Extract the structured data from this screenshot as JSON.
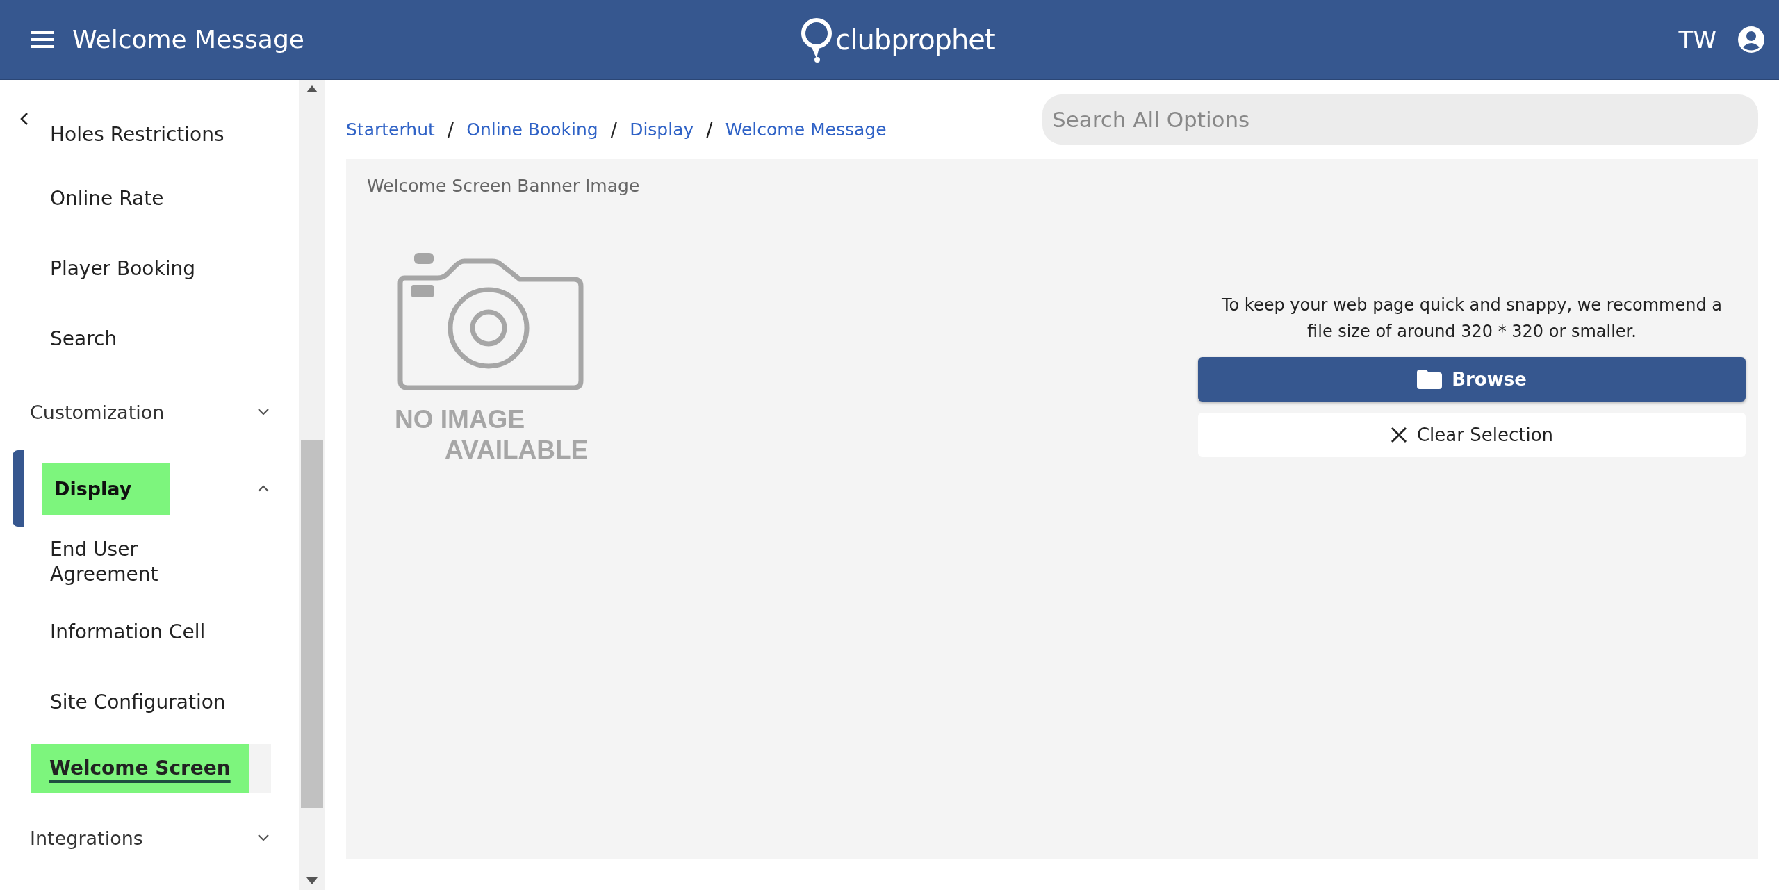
{
  "header": {
    "title": "Welcome Message",
    "logo_text": "clubprophet",
    "user_initials": "TW"
  },
  "sidebar": {
    "items": [
      {
        "kind": "link",
        "label": "Holes Restrictions",
        "selected": false,
        "highlighted": false
      },
      {
        "kind": "link",
        "label": "Online Rate",
        "selected": false,
        "highlighted": false
      },
      {
        "kind": "link",
        "label": "Player Booking",
        "selected": false,
        "highlighted": false
      },
      {
        "kind": "link",
        "label": "Search",
        "selected": false,
        "highlighted": false
      },
      {
        "kind": "group",
        "label": "Customization",
        "expanded": false,
        "active": false,
        "highlighted": false
      },
      {
        "kind": "group",
        "label": "Display",
        "expanded": true,
        "active": true,
        "highlighted": true,
        "children": [
          {
            "kind": "link",
            "label": "End User\nAgreement",
            "selected": false,
            "highlighted": false
          },
          {
            "kind": "link",
            "label": "Information Cell",
            "selected": false,
            "highlighted": false
          },
          {
            "kind": "link",
            "label": "Site Configuration",
            "selected": false,
            "highlighted": false
          },
          {
            "kind": "link",
            "label": "Welcome Screen",
            "selected": true,
            "highlighted": true
          }
        ]
      },
      {
        "kind": "group",
        "label": "Integrations",
        "expanded": false,
        "active": false,
        "highlighted": false
      }
    ]
  },
  "breadcrumb": {
    "separator": "/",
    "items": [
      "Starterhut",
      "Online Booking",
      "Display",
      "Welcome Message"
    ]
  },
  "search": {
    "placeholder": "Search All Options"
  },
  "panel": {
    "label": "Welcome Screen Banner Image",
    "image_text": [
      "NO IMAGE",
      "AVAILABLE"
    ],
    "hint": "To keep your web page quick and snappy, we recommend a file size of around 320 * 320 or smaller.",
    "buttons": [
      {
        "kind": "primary",
        "label": "Browse"
      },
      {
        "kind": "clear",
        "label": "Clear Selection"
      }
    ]
  }
}
